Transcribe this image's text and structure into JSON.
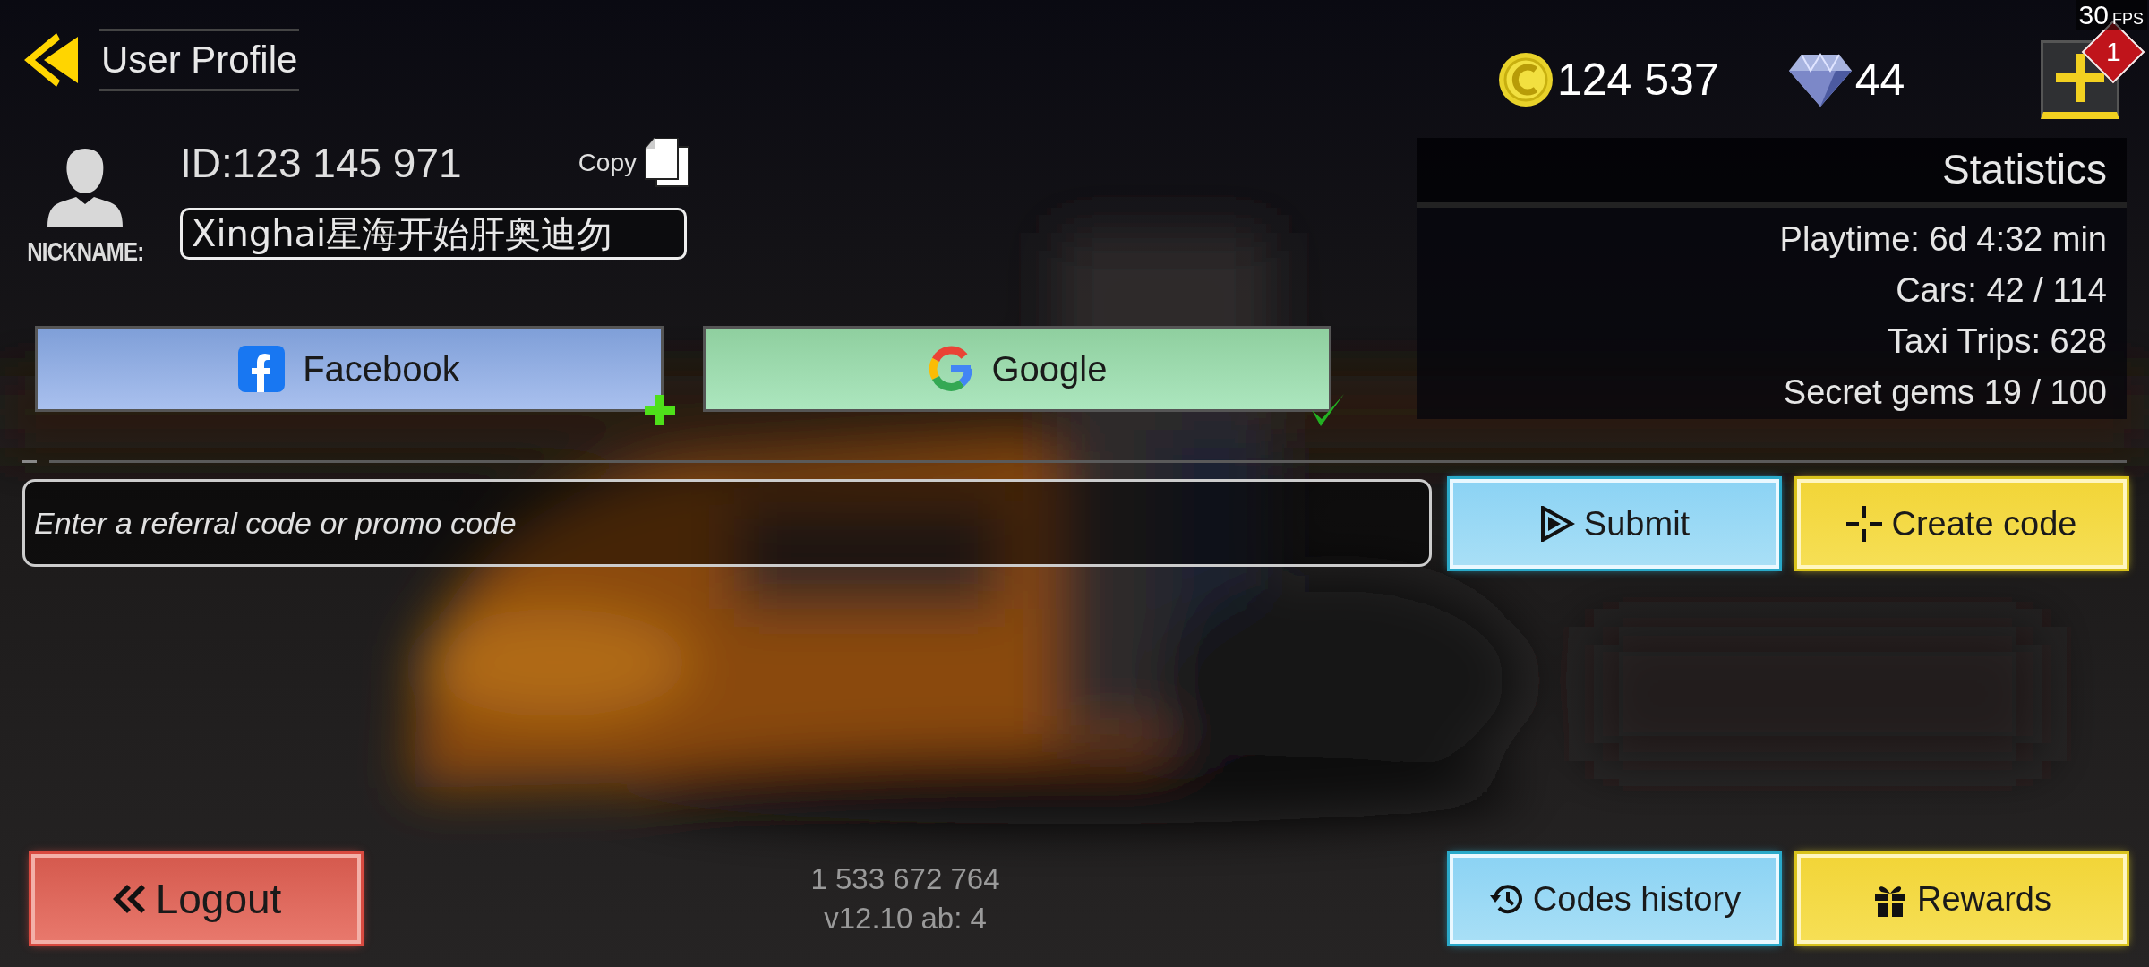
{
  "header": {
    "title": "User Profile"
  },
  "profile": {
    "id": "ID:123 145 971",
    "copy_label": "Copy",
    "nickname_label": "NICKNAME:",
    "nickname": "Xinghai星海开始肝奥迪勿"
  },
  "currency": {
    "coins": "124 537",
    "gems": "44",
    "add_badge": "1"
  },
  "fps": {
    "value": "30",
    "unit": "FPS"
  },
  "accounts": [
    {
      "kind": "facebook",
      "label": "Facebook",
      "linked": false
    },
    {
      "kind": "google",
      "label": "Google",
      "linked": true
    }
  ],
  "statistics": {
    "title": "Statistics",
    "rows": [
      {
        "label": "Playtime:",
        "value": "6d 4:32 min"
      },
      {
        "label": "Cars:",
        "value": "42 / 114"
      },
      {
        "label": "Taxi Trips:",
        "value": "628"
      },
      {
        "label": "Secret gems",
        "value": "19 / 100"
      }
    ]
  },
  "promo": {
    "placeholder": "Enter a referral code or promo code"
  },
  "actions": [
    {
      "kind": "submit",
      "label": "Submit"
    },
    {
      "kind": "create",
      "label": "Create code"
    }
  ],
  "footer": {
    "logout": "Logout",
    "player_count": "1 533 672 764",
    "version": "v12.10 ab: 4",
    "buttons": [
      {
        "kind": "history",
        "label": "Codes history"
      },
      {
        "kind": "rewards",
        "label": "Rewards"
      }
    ]
  }
}
